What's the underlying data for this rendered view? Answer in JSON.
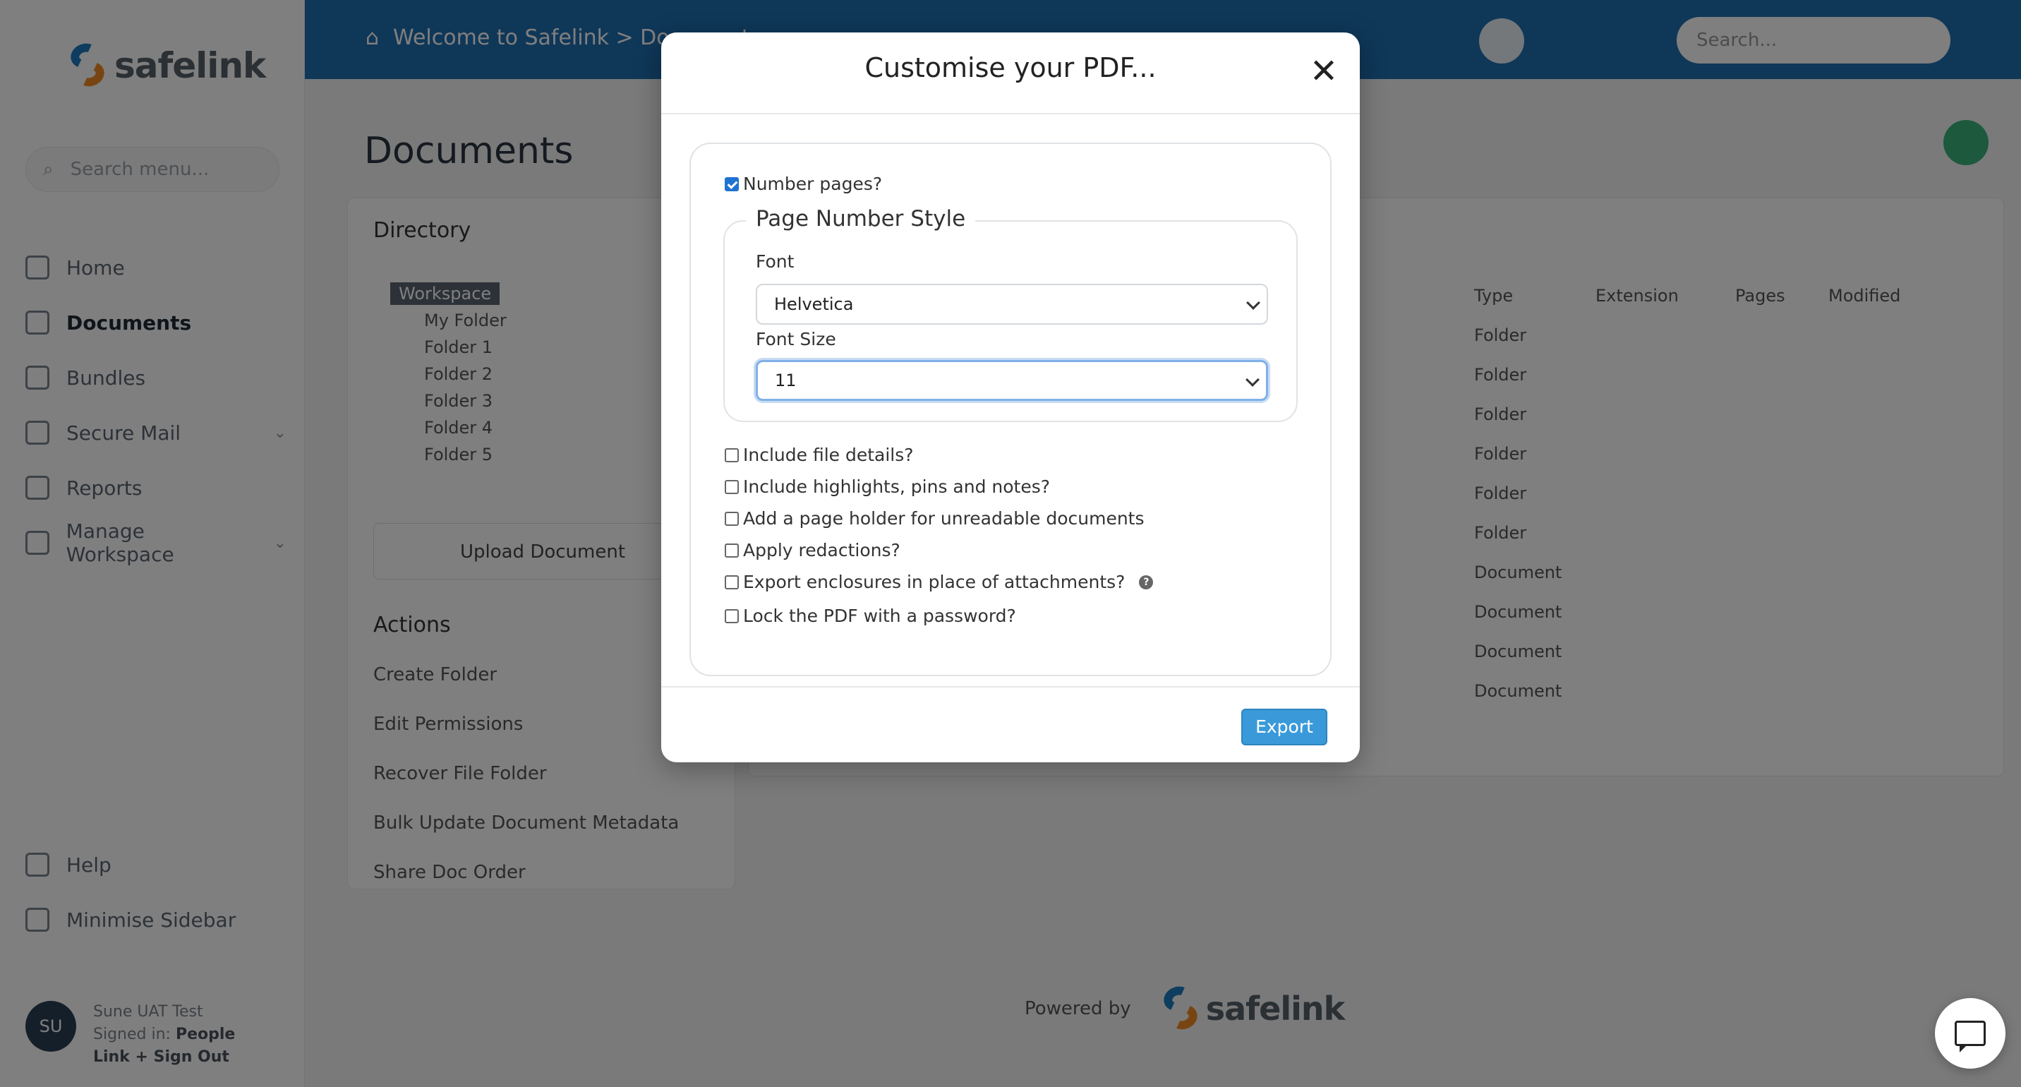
{
  "background": {
    "logo_text": "safelink",
    "sidebar_search_placeholder": "Search menu...",
    "nav": [
      "Home",
      "Documents",
      "Bundles",
      "Secure Mail",
      "Reports",
      "Manage Workspace"
    ],
    "nav_bottom": [
      "Help",
      "Minimise Sidebar"
    ],
    "user": {
      "initials": "SU",
      "name": "Sune UAT Test",
      "signed_in": "Signed in: ",
      "org": "People Link + Sign Out"
    },
    "breadcrumb": "Welcome to Safelink  >  Documents",
    "top_search_placeholder": "Search...",
    "page_title": "Documents",
    "directory_heading": "Directory",
    "tree": [
      "Workspace",
      "My Folder",
      "Folder 1",
      "Folder 2",
      "Folder 3",
      "Folder 4",
      "Folder 5"
    ],
    "upload_label": "Upload Document",
    "actions_heading": "Actions",
    "actions": [
      "Create Folder",
      "Edit Permissions",
      "Recover File Folder",
      "Bulk Update Document Metadata",
      "Share Doc Order"
    ],
    "table_headers": [
      "Type",
      "Extension",
      "Pages",
      "Modified"
    ],
    "table_types": [
      "Folder",
      "Folder",
      "Folder",
      "Folder",
      "Folder",
      "Folder",
      "Document",
      "Document",
      "Document",
      "Document"
    ],
    "footer_powered_by": "Powered by",
    "footer_logo": "safelink"
  },
  "modal": {
    "title": "Customise your PDF...",
    "close_glyph": "✕",
    "number_pages": {
      "label": "Number pages?",
      "checked": true
    },
    "page_number_style": {
      "legend": "Page Number Style",
      "font_label": "Font",
      "font_value": "Helvetica",
      "font_size_label": "Font Size",
      "font_size_value": "11"
    },
    "options": [
      {
        "label": "Include file details?",
        "checked": false
      },
      {
        "label": "Include highlights, pins and notes?",
        "checked": false
      },
      {
        "label": "Add a page holder for unreadable documents",
        "checked": false
      },
      {
        "label": "Apply redactions?",
        "checked": false
      },
      {
        "label": "Export enclosures in place of attachments?",
        "checked": false,
        "help": "?"
      },
      {
        "label": "Lock the PDF with a password?",
        "checked": false
      }
    ],
    "export_label": "Export"
  },
  "colors": {
    "primary_blue": "#1f6fb0",
    "button_blue": "#3a9ad9",
    "checkbox_checked": "#1f73d0",
    "overlay": "rgba(0,0,0,0.5)"
  },
  "icons": [
    "search-icon",
    "home-icon",
    "documents-icon",
    "bundles-icon",
    "mail-icon",
    "reports-icon",
    "manage-icon",
    "help-icon",
    "minimise-icon",
    "close-icon",
    "chevron-down-icon",
    "question-icon",
    "chat-icon"
  ]
}
